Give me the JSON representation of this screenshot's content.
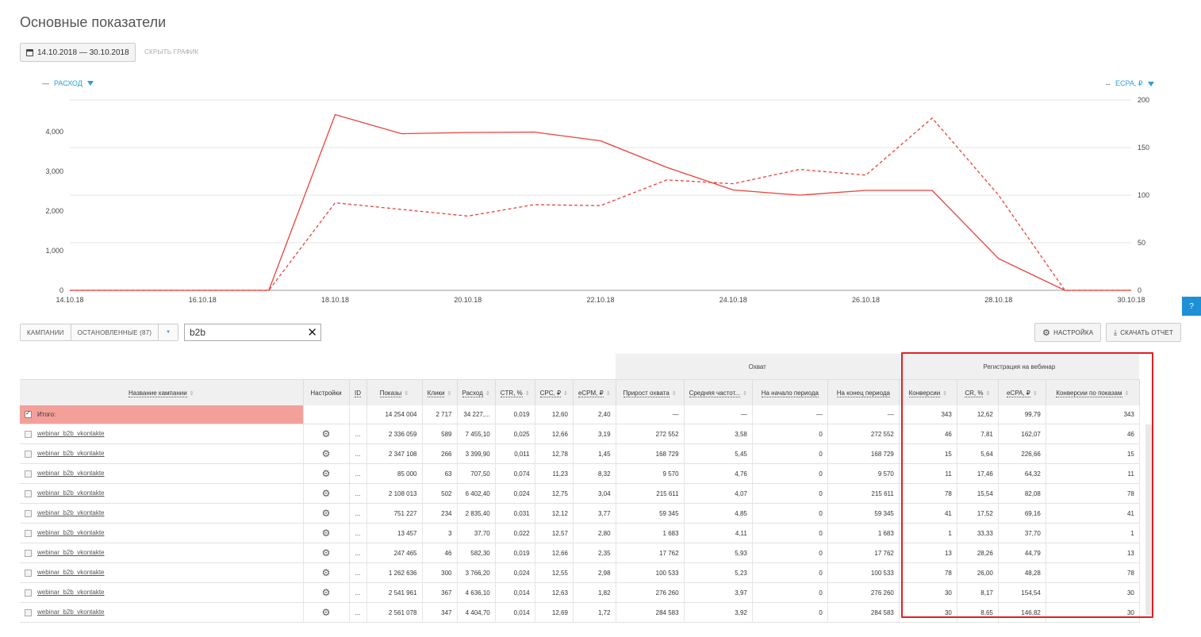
{
  "page_title": "Основные показатели",
  "toolbar": {
    "date_range": "14.10.2018 — 30.10.2018",
    "hide_chart": "СКРЫТЬ ГРАФИК"
  },
  "chart_legend": {
    "left": "РАСХОД",
    "right": "ECPA, ₽",
    "left_marker": "—",
    "right_marker": "--"
  },
  "chart_data": {
    "type": "line",
    "x": [
      "14.10.18",
      "15.10.18",
      "16.10.18",
      "17.10.18",
      "18.10.18",
      "19.10.18",
      "20.10.18",
      "21.10.18",
      "22.10.18",
      "23.10.18",
      "24.10.18",
      "25.10.18",
      "26.10.18",
      "27.10.18",
      "28.10.18",
      "29.10.18",
      "30.10.18"
    ],
    "x_tick_labels": [
      "14.10.18",
      "16.10.18",
      "18.10.18",
      "20.10.18",
      "22.10.18",
      "24.10.18",
      "26.10.18",
      "28.10.18",
      "30.10.18"
    ],
    "y_left": {
      "ticks": [
        "0",
        "1,000",
        "2,000",
        "3,000",
        "4,000"
      ],
      "range": [
        0,
        4800
      ]
    },
    "y_right": {
      "ticks": [
        "0",
        "50",
        "100",
        "150",
        "200"
      ],
      "range": [
        0,
        200
      ]
    },
    "series": [
      {
        "name": "РАСХОД",
        "axis": "left",
        "style": "solid",
        "color": "#e8423a",
        "values": [
          0,
          0,
          0,
          0,
          4430,
          3950,
          3980,
          3990,
          3770,
          3100,
          2530,
          2400,
          2520,
          2520,
          800,
          0,
          0
        ]
      },
      {
        "name": "ECPA, ₽",
        "axis": "right",
        "style": "dashed",
        "color": "#e8423a",
        "values": [
          0,
          0,
          0,
          0,
          92,
          85,
          78,
          90,
          89,
          116,
          112,
          127,
          121,
          181,
          100,
          0,
          0
        ]
      }
    ]
  },
  "filters": {
    "campaigns_tab": "КАМПАНИИ",
    "stopped_tab": "ОСТАНОВЛЕННЫЕ (87)",
    "dropdown_marker": "▼",
    "search_value": "b2b",
    "settings_button": "НАСТРОЙКА",
    "download_button": "СКАЧАТЬ ОТЧЕТ",
    "help": "?"
  },
  "table": {
    "group_headers": {
      "reach": "Охват",
      "webinar": "Регистрация на вебинар"
    },
    "columns": {
      "name": "Название кампании",
      "settings": "Настройки",
      "id": "ID",
      "impressions": "Показы",
      "clicks": "Клики",
      "spend": "Расход",
      "ctr": "CTR, %",
      "cpc": "CPC, ₽",
      "ecpm": "eCPM, ₽",
      "reach_growth": "Прирост охвата",
      "avg_freq": "Средняя частот...",
      "period_start": "На начало периода",
      "period_end": "На конец периода",
      "conversions": "Конверсии",
      "cr": "CR, %",
      "ecpa": "eCPA, ₽",
      "conv_by_impr": "Конверсии по показам"
    },
    "total": {
      "name": "Итого:",
      "impressions": "14 254 004",
      "clicks": "2 717",
      "spend": "34 227,...",
      "ctr": "0,019",
      "cpc": "12,60",
      "ecpm": "2,40",
      "reach_growth": "—",
      "avg_freq": "—",
      "period_start": "—",
      "period_end": "—",
      "conversions": "343",
      "cr": "12,62",
      "ecpa": "99,79",
      "conv_by_impr": "343"
    },
    "rows": [
      {
        "name": "webinar_b2b_vkontakte",
        "id": "...",
        "impressions": "2 336 059",
        "clicks": "589",
        "spend": "7 455,10",
        "ctr": "0,025",
        "cpc": "12,66",
        "ecpm": "3,19",
        "reach_growth": "272 552",
        "avg_freq": "3,58",
        "period_start": "0",
        "period_end": "272 552",
        "conversions": "46",
        "cr": "7,81",
        "ecpa": "162,07",
        "conv_by_impr": "46"
      },
      {
        "name": "webinar_b2b_vkontakte",
        "id": "...",
        "impressions": "2 347 108",
        "clicks": "266",
        "spend": "3 399,90",
        "ctr": "0,011",
        "cpc": "12,78",
        "ecpm": "1,45",
        "reach_growth": "168 729",
        "avg_freq": "5,45",
        "period_start": "0",
        "period_end": "168 729",
        "conversions": "15",
        "cr": "5,64",
        "ecpa": "226,66",
        "conv_by_impr": "15"
      },
      {
        "name": "webinar_b2b_vkontakte",
        "id": "...",
        "impressions": "85 000",
        "clicks": "63",
        "spend": "707,50",
        "ctr": "0,074",
        "cpc": "11,23",
        "ecpm": "8,32",
        "reach_growth": "9 570",
        "avg_freq": "4,76",
        "period_start": "0",
        "period_end": "9 570",
        "conversions": "11",
        "cr": "17,46",
        "ecpa": "64,32",
        "conv_by_impr": "11"
      },
      {
        "name": "webinar_b2b_vkontakte",
        "id": "...",
        "impressions": "2 108 013",
        "clicks": "502",
        "spend": "6 402,40",
        "ctr": "0,024",
        "cpc": "12,75",
        "ecpm": "3,04",
        "reach_growth": "215 611",
        "avg_freq": "4,07",
        "period_start": "0",
        "period_end": "215 611",
        "conversions": "78",
        "cr": "15,54",
        "ecpa": "82,08",
        "conv_by_impr": "78"
      },
      {
        "name": "webinar_b2b_vkontakte",
        "id": "...",
        "impressions": "751 227",
        "clicks": "234",
        "spend": "2 835,40",
        "ctr": "0,031",
        "cpc": "12,12",
        "ecpm": "3,77",
        "reach_growth": "59 345",
        "avg_freq": "4,85",
        "period_start": "0",
        "period_end": "59 345",
        "conversions": "41",
        "cr": "17,52",
        "ecpa": "69,16",
        "conv_by_impr": "41"
      },
      {
        "name": "webinar_b2b_vkontakte",
        "id": "...",
        "impressions": "13 457",
        "clicks": "3",
        "spend": "37,70",
        "ctr": "0,022",
        "cpc": "12,57",
        "ecpm": "2,80",
        "reach_growth": "1 683",
        "avg_freq": "4,11",
        "period_start": "0",
        "period_end": "1 683",
        "conversions": "1",
        "cr": "33,33",
        "ecpa": "37,70",
        "conv_by_impr": "1"
      },
      {
        "name": "webinar_b2b_vkontakte",
        "id": "...",
        "impressions": "247 465",
        "clicks": "46",
        "spend": "582,30",
        "ctr": "0,019",
        "cpc": "12,66",
        "ecpm": "2,35",
        "reach_growth": "17 762",
        "avg_freq": "5,93",
        "period_start": "0",
        "period_end": "17 762",
        "conversions": "13",
        "cr": "28,26",
        "ecpa": "44,79",
        "conv_by_impr": "13"
      },
      {
        "name": "webinar_b2b_vkontakte",
        "id": "...",
        "impressions": "1 262 636",
        "clicks": "300",
        "spend": "3 766,20",
        "ctr": "0,024",
        "cpc": "12,55",
        "ecpm": "2,98",
        "reach_growth": "100 533",
        "avg_freq": "5,23",
        "period_start": "0",
        "period_end": "100 533",
        "conversions": "78",
        "cr": "26,00",
        "ecpa": "48,28",
        "conv_by_impr": "78"
      },
      {
        "name": "webinar_b2b_vkontakte",
        "id": "...",
        "impressions": "2 541 961",
        "clicks": "367",
        "spend": "4 636,10",
        "ctr": "0,014",
        "cpc": "12,63",
        "ecpm": "1,82",
        "reach_growth": "276 260",
        "avg_freq": "3,97",
        "period_start": "0",
        "period_end": "276 260",
        "conversions": "30",
        "cr": "8,17",
        "ecpa": "154,54",
        "conv_by_impr": "30"
      },
      {
        "name": "webinar_b2b_vkontakte",
        "id": "...",
        "impressions": "2 561 078",
        "clicks": "347",
        "spend": "4 404,70",
        "ctr": "0,014",
        "cpc": "12,69",
        "ecpm": "1,72",
        "reach_growth": "284 583",
        "avg_freq": "3,92",
        "period_start": "0",
        "period_end": "284 583",
        "conversions": "30",
        "cr": "8,65",
        "ecpa": "146,82",
        "conv_by_impr": "30"
      }
    ]
  },
  "colors": {
    "accent": "#2a9fd6",
    "line": "#e8423a",
    "highlight_frame": "#e31e24",
    "total_row": "#f4a09a"
  }
}
